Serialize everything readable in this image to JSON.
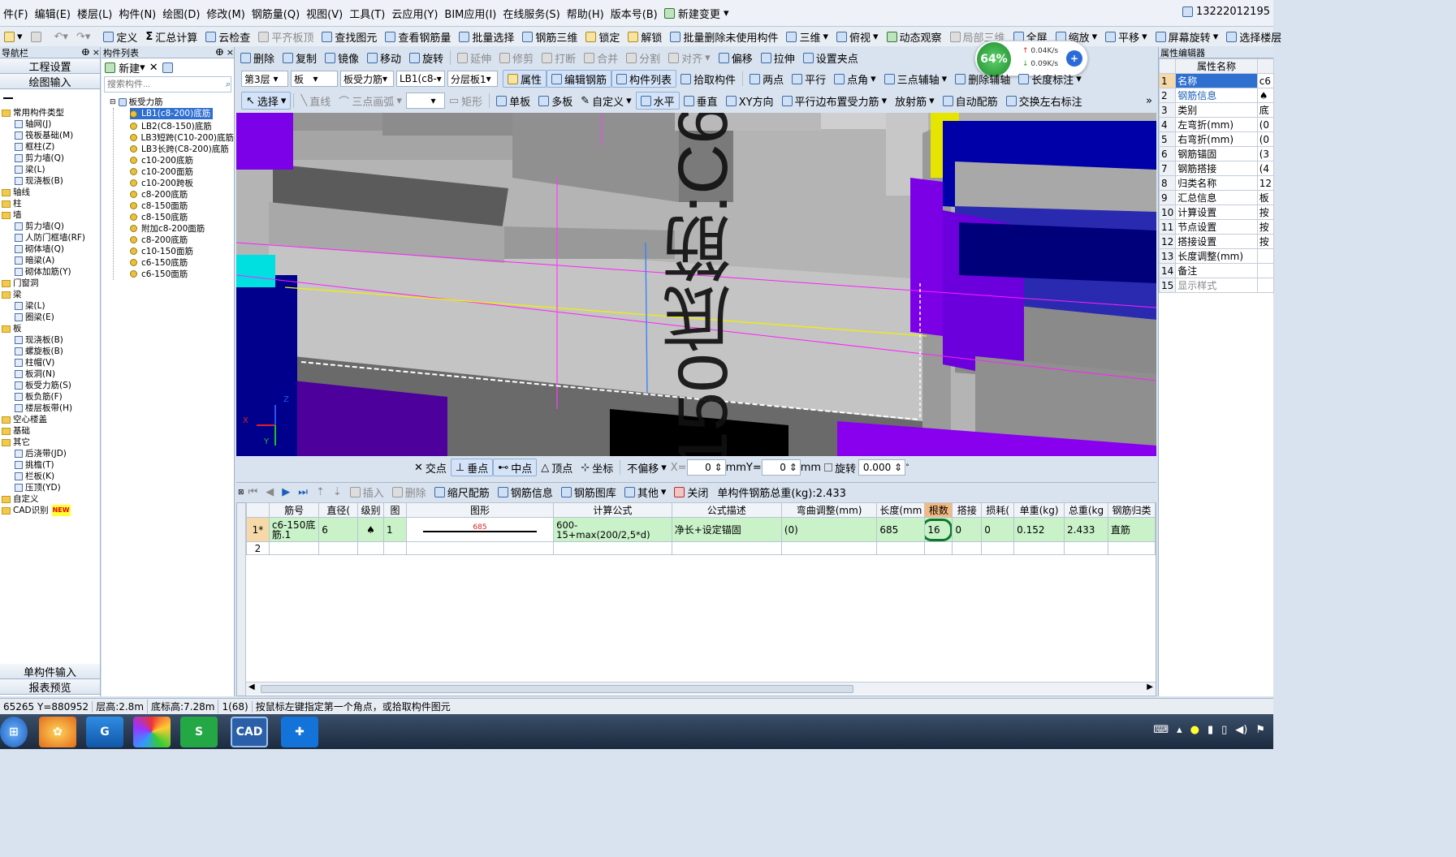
{
  "menu": {
    "items": [
      "件(F)",
      "编辑(E)",
      "楼层(L)",
      "构件(N)",
      "绘图(D)",
      "修改(M)",
      "钢筋量(Q)",
      "视图(V)",
      "工具(T)",
      "云应用(Y)",
      "BIM应用(I)",
      "在线服务(S)",
      "帮助(H)",
      "版本号(B)",
      "新建变更"
    ],
    "user": "13222012195"
  },
  "toolbar1": {
    "define": "定义",
    "calc": "汇总计算",
    "cloud_check": "云检查",
    "flat_top": "平齐板顶",
    "find": "查找图元",
    "view_rebar": "查看钢筋量",
    "batch_select": "批量选择",
    "rebar_3d": "钢筋三维",
    "lock": "锁定",
    "unlock": "解锁",
    "batch_delete": "批量删除未使用构件",
    "three_d": "三维",
    "top_view": "俯视",
    "dynamic": "动态观察",
    "local_3d": "局部三维",
    "fullscreen": "全屏",
    "zoom": "缩放",
    "pan": "平移",
    "screen_rotate": "屏幕旋转",
    "select_floor": "选择楼层"
  },
  "toolbar2": {
    "delete": "删除",
    "copy": "复制",
    "mirror": "镜像",
    "move": "移动",
    "rotate": "旋转",
    "extend": "延伸",
    "trim": "修剪",
    "break": "打断",
    "merge": "合并",
    "split": "分割",
    "align": "对齐",
    "offset": "偏移",
    "stretch": "拉伸",
    "set_grip": "设置夹点"
  },
  "toolbar3": {
    "floor": "第3层",
    "category": "板",
    "type": "板受力筋",
    "component": "LB1(c8-",
    "layer": "分层板1",
    "properties": "属性",
    "edit_rebar": "编辑钢筋",
    "comp_list": "构件列表",
    "pick": "拾取构件",
    "two_points": "两点",
    "parallel": "平行",
    "point_angle": "点角",
    "three_aux": "三点辅轴",
    "del_aux": "删除辅轴",
    "len_mark": "长度标注"
  },
  "toolbar4": {
    "select": "选择",
    "line": "直线",
    "arc": "三点画弧",
    "rect": "矩形",
    "single": "单板",
    "multi": "多板",
    "custom": "自定义",
    "horizontal": "水平",
    "vertical": "垂直",
    "xy": "XY方向",
    "parallel_edge": "平行边布置受力筋",
    "radial": "放射筋",
    "auto": "自动配筋",
    "swap": "交换左右标注"
  },
  "speed": {
    "percent": "64%",
    "up": "0.04K/s",
    "down": "0.09K/s"
  },
  "nav": {
    "title": "导航栏",
    "btn_setup": "工程设置",
    "btn_draw": "绘图输入",
    "tree": [
      {
        "label": "常用构件类型",
        "type": "folder"
      },
      {
        "label": "轴网(J)",
        "type": "leaf"
      },
      {
        "label": "筏板基础(M)",
        "type": "leaf"
      },
      {
        "label": "框柱(Z)",
        "type": "leaf"
      },
      {
        "label": "剪力墙(Q)",
        "type": "leaf"
      },
      {
        "label": "梁(L)",
        "type": "leaf"
      },
      {
        "label": "现浇板(B)",
        "type": "leaf"
      },
      {
        "label": "轴线",
        "type": "folder"
      },
      {
        "label": "柱",
        "type": "folder"
      },
      {
        "label": "墙",
        "type": "folder"
      },
      {
        "label": "剪力墙(Q)",
        "type": "leaf"
      },
      {
        "label": "人防门框墙(RF)",
        "type": "leaf"
      },
      {
        "label": "砌体墙(Q)",
        "type": "leaf"
      },
      {
        "label": "暗梁(A)",
        "type": "leaf"
      },
      {
        "label": "砌体加筋(Y)",
        "type": "leaf"
      },
      {
        "label": "门窗洞",
        "type": "folder"
      },
      {
        "label": "梁",
        "type": "folder"
      },
      {
        "label": "梁(L)",
        "type": "leaf"
      },
      {
        "label": "圈梁(E)",
        "type": "leaf"
      },
      {
        "label": "板",
        "type": "folder"
      },
      {
        "label": "现浇板(B)",
        "type": "leaf"
      },
      {
        "label": "螺旋板(B)",
        "type": "leaf"
      },
      {
        "label": "柱帽(V)",
        "type": "leaf"
      },
      {
        "label": "板洞(N)",
        "type": "leaf"
      },
      {
        "label": "板受力筋(S)",
        "type": "leaf"
      },
      {
        "label": "板负筋(F)",
        "type": "leaf"
      },
      {
        "label": "楼层板带(H)",
        "type": "leaf"
      },
      {
        "label": "空心楼盖",
        "type": "folder"
      },
      {
        "label": "基础",
        "type": "folder"
      },
      {
        "label": "其它",
        "type": "folder"
      },
      {
        "label": "后浇带(JD)",
        "type": "leaf"
      },
      {
        "label": "挑檐(T)",
        "type": "leaf"
      },
      {
        "label": "栏板(K)",
        "type": "leaf"
      },
      {
        "label": "压顶(YD)",
        "type": "leaf"
      },
      {
        "label": "自定义",
        "type": "folder"
      },
      {
        "label": "CAD识别",
        "type": "folder"
      }
    ],
    "new_badge": "NEW",
    "btn_single": "单构件输入",
    "btn_report": "报表预览"
  },
  "complist": {
    "title": "构件列表",
    "new_btn": "新建",
    "search_placeholder": "搜索构件...",
    "root": "板受力筋",
    "items": [
      "LB1(c8-200)底筋",
      "LB2(C8-150)底筋",
      "LB3短跨(C10-200)底筋",
      "LB3长跨(C8-200)底筋",
      "c10-200底筋",
      "c10-200面筋",
      "c10-200跨板",
      "c8-200底筋",
      "c8-150面筋",
      "c8-150底筋",
      "附加c8-200面筋",
      "c8-200底筋",
      "c10-150面筋",
      "c6-150底筋",
      "c6-150面筋"
    ]
  },
  "view": {
    "overlay_text": "150底筋:C6"
  },
  "snap": {
    "intersect": "交点",
    "perp": "垂点",
    "mid": "中点",
    "vertex": "顶点",
    "coord": "坐标",
    "no_offset": "不偏移",
    "x_label": "X=",
    "x_val": "0",
    "mm": "mm",
    "y_label": "Y=",
    "y_val": "0",
    "rotate": "旋转",
    "rot_val": "0.000"
  },
  "grid_toolbar": {
    "insert": "插入",
    "delete": "删除",
    "scale": "缩尺配筋",
    "info": "钢筋信息",
    "lib": "钢筋图库",
    "other": "其他",
    "close": "关闭",
    "total": "单构件钢筋总重(kg):2.433"
  },
  "grid": {
    "headers": [
      "筋号",
      "直径(",
      "级别",
      "图",
      "图形",
      "计算公式",
      "公式描述",
      "弯曲调整(mm)",
      "长度(mm",
      "根数",
      "搭接",
      "损耗(",
      "单重(kg)",
      "总重(kg",
      "钢筋归类"
    ],
    "rows": [
      {
        "idx": "1*",
        "name": "c6-150底筋.1",
        "dia": "6",
        "grade": "♠",
        "fig": "1",
        "shape_val": "685",
        "formula": "600-15+max(200/2,5*d)",
        "desc": "净长+设定锚固",
        "bend": "(0)",
        "len": "685",
        "count": "16",
        "lap": "0",
        "loss": "0",
        "unit_w": "0.152",
        "total_w": "2.433",
        "cat": "直筋"
      },
      {
        "idx": "2",
        "name": "",
        "dia": "",
        "grade": "",
        "fig": "",
        "shape_val": "",
        "formula": "",
        "desc": "",
        "bend": "",
        "len": "",
        "count": "",
        "lap": "",
        "loss": "",
        "unit_w": "",
        "total_w": "",
        "cat": ""
      }
    ]
  },
  "props": {
    "title": "属性编辑器",
    "col": "属性名称",
    "rows": [
      {
        "n": "1",
        "name": "名称",
        "val": "c6"
      },
      {
        "n": "2",
        "name": "钢筋信息",
        "val": "♠"
      },
      {
        "n": "3",
        "name": "类别",
        "val": "底"
      },
      {
        "n": "4",
        "name": "左弯折(mm)",
        "val": "(0"
      },
      {
        "n": "5",
        "name": "右弯折(mm)",
        "val": "(0"
      },
      {
        "n": "6",
        "name": "钢筋锚固",
        "val": "(3"
      },
      {
        "n": "7",
        "name": "钢筋搭接",
        "val": "(4"
      },
      {
        "n": "8",
        "name": "归类名称",
        "val": "12"
      },
      {
        "n": "9",
        "name": "汇总信息",
        "val": "板"
      },
      {
        "n": "10",
        "name": "计算设置",
        "val": "按"
      },
      {
        "n": "11",
        "name": "节点设置",
        "val": "按"
      },
      {
        "n": "12",
        "name": "搭接设置",
        "val": "按"
      },
      {
        "n": "13",
        "name": "长度调整(mm)",
        "val": ""
      },
      {
        "n": "14",
        "name": "备注",
        "val": ""
      },
      {
        "n": "15",
        "name": "显示样式",
        "val": ""
      }
    ]
  },
  "status": {
    "coords": "65265 Y=880952",
    "floor_h": "层高:2.8m",
    "base_h": "底标高:7.28m",
    "count": "1(68)",
    "hint": "按鼠标左键指定第一个角点，或拾取构件图元"
  },
  "colors": {
    "accent": "#1c5fb8",
    "selected_row": "#c9f2c9",
    "purple": "#7a00e6",
    "navy": "#0c0c7a"
  }
}
